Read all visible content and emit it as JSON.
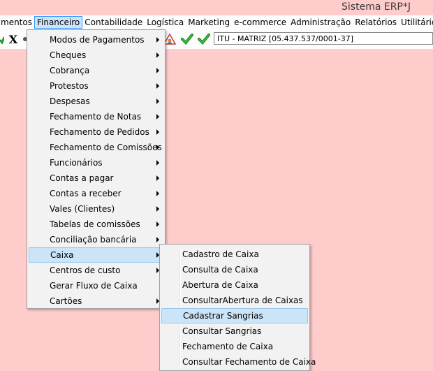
{
  "window": {
    "title": "Sistema ERP*J"
  },
  "menubar": [
    {
      "label": "mentos"
    },
    {
      "label": "Financeiro"
    },
    {
      "label": "Contabilidade"
    },
    {
      "label": "Logística"
    },
    {
      "label": "Marketing"
    },
    {
      "label": "e-commerce"
    },
    {
      "label": "Administração"
    },
    {
      "label": "Relatórios"
    },
    {
      "label": "Utilitários"
    }
  ],
  "toolbar": {
    "close_glyph": "X",
    "company": "ITU - MATRIZ [05.437.537/0001-37]"
  },
  "financeiro_menu": [
    {
      "label": "Modos de Pagamentos",
      "submenu": true
    },
    {
      "label": "Cheques",
      "submenu": true
    },
    {
      "label": "Cobrança",
      "submenu": true
    },
    {
      "label": "Protestos",
      "submenu": true
    },
    {
      "label": "Despesas",
      "submenu": true
    },
    {
      "label": "Fechamento de Notas",
      "submenu": true
    },
    {
      "label": "Fechamento de Pedidos",
      "submenu": true
    },
    {
      "label": "Fechamento de Comissões",
      "submenu": true
    },
    {
      "label": "Funcionários",
      "submenu": true
    },
    {
      "label": "Contas a pagar",
      "submenu": true
    },
    {
      "label": "Contas a receber",
      "submenu": true
    },
    {
      "label": "Vales (Clientes)",
      "submenu": true
    },
    {
      "label": "Tabelas de comissões",
      "submenu": true
    },
    {
      "label": "Conciliação bancária",
      "submenu": true
    },
    {
      "label": "Caixa",
      "submenu": true
    },
    {
      "label": "Centros de custo",
      "submenu": true
    },
    {
      "label": "Gerar Fluxo de Caixa",
      "submenu": false
    },
    {
      "label": "Cartões",
      "submenu": true
    }
  ],
  "caixa_menu": [
    {
      "label": "Cadastro de Caixa"
    },
    {
      "label": "Consulta de Caixa"
    },
    {
      "label": "Abertura de Caixa"
    },
    {
      "label": "ConsultarAbertura de Caixas"
    },
    {
      "label": "Cadastrar Sangrias"
    },
    {
      "label": "Consultar Sangrias"
    },
    {
      "label": "Fechamento de Caixa"
    },
    {
      "label": "Consultar Fechamento de Caixa"
    }
  ],
  "colors": {
    "background": "#ffcccc",
    "highlight": "#cce4f7",
    "highlight_border": "#99c9ef"
  }
}
